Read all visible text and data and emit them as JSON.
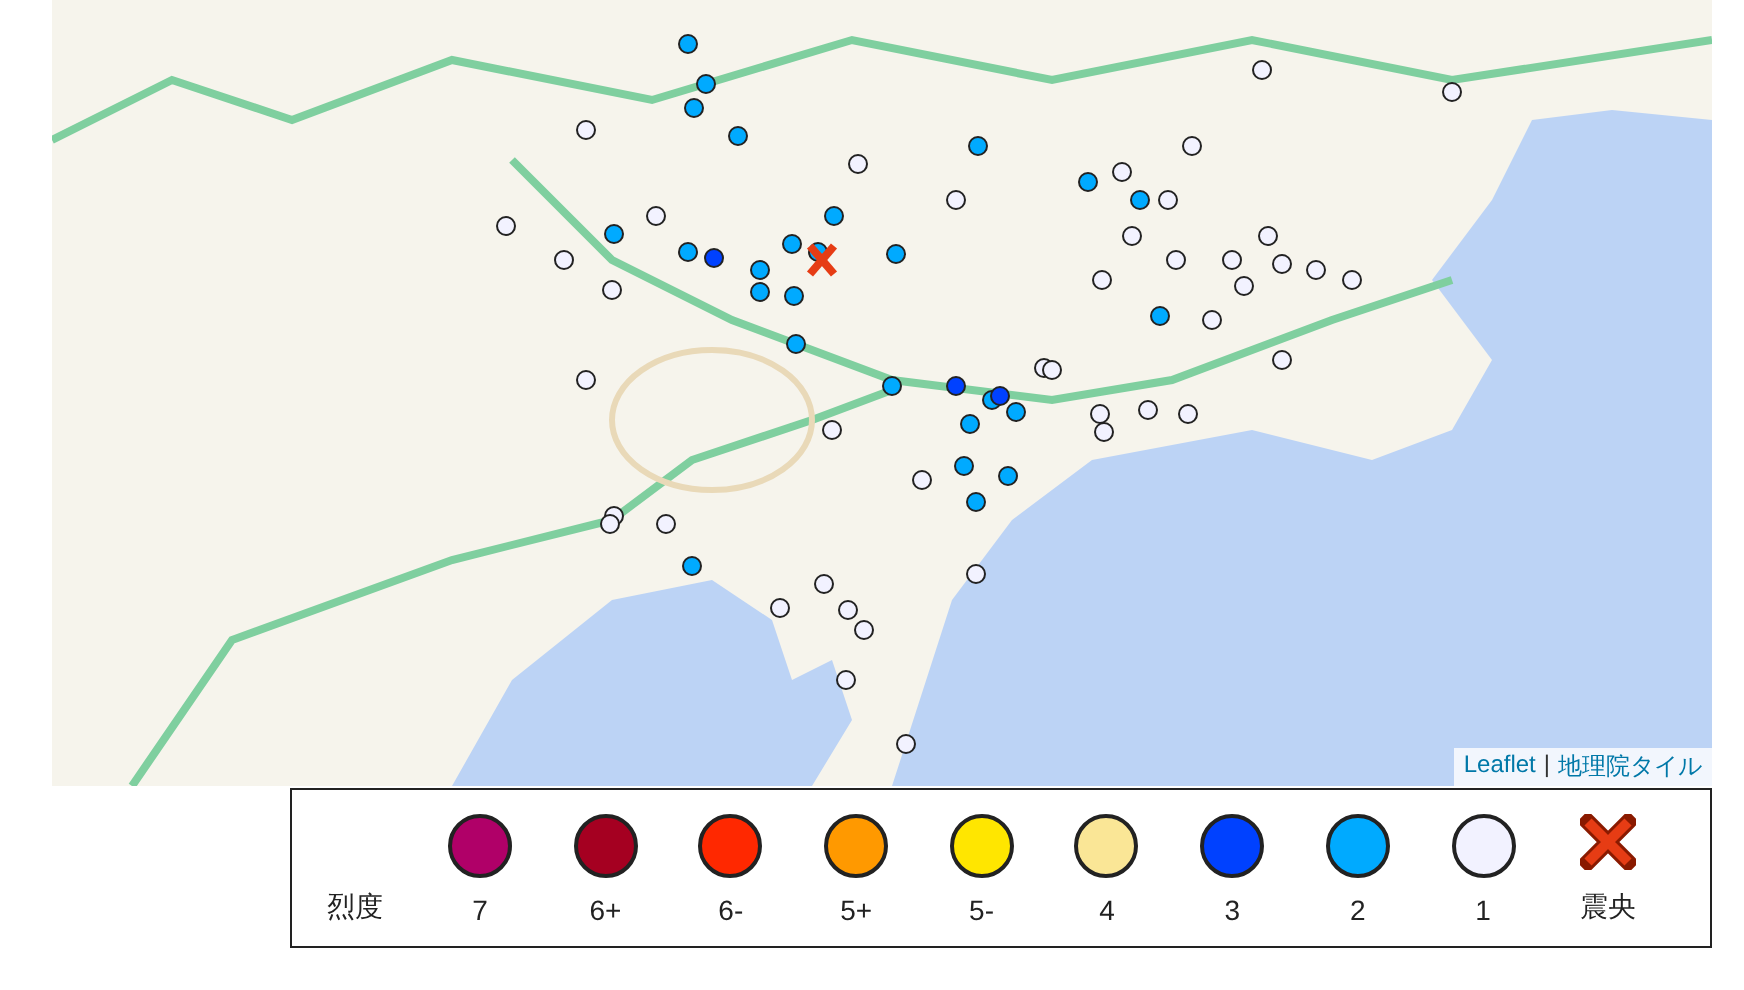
{
  "map": {
    "attribution": [
      {
        "kind": "link",
        "text": "Leaflet"
      },
      {
        "kind": "separator",
        "text": "|"
      },
      {
        "kind": "link",
        "text": "地理院タイル"
      }
    ]
  },
  "legend": {
    "title": "烈度",
    "items": [
      {
        "kind": "dot",
        "label": "7",
        "color": "#b00068"
      },
      {
        "kind": "dot",
        "label": "6+",
        "color": "#a50021"
      },
      {
        "kind": "dot",
        "label": "6-",
        "color": "#ff2800"
      },
      {
        "kind": "dot",
        "label": "5+",
        "color": "#ff9900"
      },
      {
        "kind": "dot",
        "label": "5-",
        "color": "#ffe600"
      },
      {
        "kind": "dot",
        "label": "4",
        "color": "#fae696"
      },
      {
        "kind": "dot",
        "label": "3",
        "color": "#0041ff"
      },
      {
        "kind": "dot",
        "label": "2",
        "color": "#00aaff"
      },
      {
        "kind": "dot",
        "label": "1",
        "color": "#f2f2ff"
      },
      {
        "kind": "cross",
        "label": "震央",
        "color": "#e63c14"
      }
    ]
  }
}
